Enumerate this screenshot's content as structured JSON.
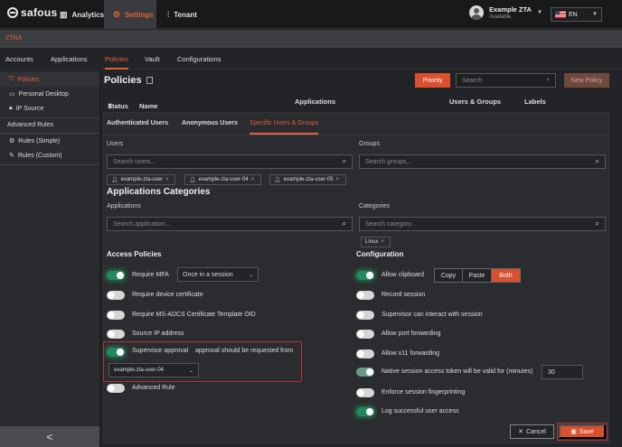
{
  "header": {
    "brand": "safous",
    "brand_sub": "",
    "nav": [
      {
        "label": "Analytics",
        "icon": "bar-chart-icon"
      },
      {
        "label": "Settings",
        "icon": "gear-icon"
      },
      {
        "label": "Tenant",
        "icon": "sliders-icon"
      }
    ],
    "user": {
      "name": "Example ZTA",
      "status": "Available"
    },
    "language": "EN"
  },
  "section": "ZTNA",
  "top_tabs": [
    "Accounts",
    "Applications",
    "Policies",
    "Vault",
    "Configurations"
  ],
  "sidebar": {
    "items": [
      {
        "label": "Policies",
        "icon": "shield-icon"
      },
      {
        "label": "Personal Desktop",
        "icon": "monitor-icon"
      },
      {
        "label": "IP Source",
        "icon": "lock-icon"
      }
    ],
    "advanced_heading": "Advanced Rules",
    "advanced_items": [
      {
        "label": "Rules (Simple)",
        "icon": "gear-icon"
      },
      {
        "label": "Rules (Custom)",
        "icon": "wrench-icon"
      }
    ],
    "collapse_glyph": "<"
  },
  "page": {
    "title": "Policies",
    "priority_label": "Priority",
    "search_placeholder": "Search",
    "new_policy_label": "New Policy",
    "columns": [
      "Status",
      "Name",
      "Applications",
      "Users & Groups",
      "Labels"
    ]
  },
  "subtabs": [
    "Authenticated Users",
    "Anonymous Users",
    "Specific Users & Groups"
  ],
  "users": {
    "label": "Users",
    "placeholder": "Search users...",
    "selected": [
      "example-zta-user",
      "example-zta-user-04",
      "example-zta-user-05"
    ]
  },
  "groups": {
    "label": "Groups",
    "placeholder": "Search groups..."
  },
  "app_categories": {
    "title": "Applications Categories",
    "applications_label": "Applications",
    "applications_placeholder": "Search application...",
    "categories_label": "Categories",
    "categories_placeholder": "Search category...",
    "selected_categories": [
      "Linux"
    ]
  },
  "access_policies": {
    "title": "Access Policies",
    "require_mfa": {
      "label": "Require MFA",
      "on": true,
      "frequency": "Once in a session"
    },
    "device_cert": {
      "label": "Require device certificate",
      "on": false
    },
    "adcs": {
      "label": "Require MS-ADCS Certificate Template OID",
      "on": false
    },
    "source_ip": {
      "label": "Source IP address",
      "on": false
    },
    "supervisor": {
      "label": "Supervisor approval",
      "hint": "approval should be requested from",
      "on": true,
      "approver": "example-zta-user-04"
    },
    "advanced_rule": {
      "label": "Advanced Rule",
      "on": false
    }
  },
  "configuration": {
    "title": "Configuration",
    "clipboard": {
      "label": "Allow clipboard",
      "on": true,
      "options": [
        "Copy",
        "Paste",
        "Both"
      ],
      "selected": "Both"
    },
    "record_session": {
      "label": "Record session",
      "on": false
    },
    "supervisor_interact": {
      "label": "Supervisor can interact with session",
      "on": false
    },
    "port_forwarding": {
      "label": "Allow port forwarding",
      "on": false
    },
    "x11": {
      "label": "Allow x11 forwarding",
      "on": false
    },
    "native_token": {
      "label": "Native session access token will be valid for (minutes)",
      "on": true,
      "minutes": "30"
    },
    "fingerprint": {
      "label": "Enforce session fingerprinting",
      "on": false
    },
    "log_access": {
      "label": "Log successful user access",
      "on": true
    }
  },
  "footer": {
    "cancel_label": "Cancel",
    "save_label": "Save"
  },
  "colors": {
    "accent": "#d9502e",
    "toggle_on": "#1f8a5c",
    "highlight": "#b3333a"
  }
}
